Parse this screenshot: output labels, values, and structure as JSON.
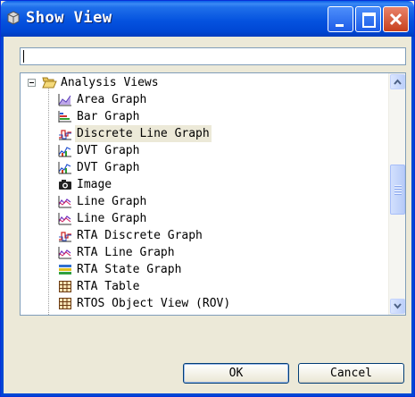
{
  "window": {
    "title": "Show View"
  },
  "titlebar_buttons": [
    "minimize",
    "maximize",
    "close"
  ],
  "filter": {
    "value": ""
  },
  "tree": {
    "folder": {
      "label": "Analysis Views",
      "icon": "folder-open-icon",
      "expanded": true
    },
    "items": [
      {
        "label": "Area Graph",
        "icon": "area-graph-icon"
      },
      {
        "label": "Bar Graph",
        "icon": "bar-graph-icon"
      },
      {
        "label": "Discrete Line Graph",
        "icon": "discrete-graph-icon",
        "selected": true
      },
      {
        "label": "DVT Graph",
        "icon": "dvt-graph-icon"
      },
      {
        "label": "DVT Graph",
        "icon": "dvt-graph-icon"
      },
      {
        "label": "Image",
        "icon": "camera-icon"
      },
      {
        "label": "Line Graph",
        "icon": "line-graph-icon"
      },
      {
        "label": "Line Graph",
        "icon": "line-graph-icon"
      },
      {
        "label": "RTA Discrete Graph",
        "icon": "discrete-graph-icon"
      },
      {
        "label": "RTA Line Graph",
        "icon": "line-graph-icon"
      },
      {
        "label": "RTA State Graph",
        "icon": "state-graph-icon"
      },
      {
        "label": "RTA Table",
        "icon": "table-icon"
      },
      {
        "label": "RTOS Object View (ROV)",
        "icon": "table-icon"
      }
    ]
  },
  "buttons": {
    "ok": "OK",
    "cancel": "Cancel"
  },
  "colors": {
    "titlebar": "#0553df",
    "selection": "#ece9d8",
    "dialog_bg": "#ece9d8"
  }
}
